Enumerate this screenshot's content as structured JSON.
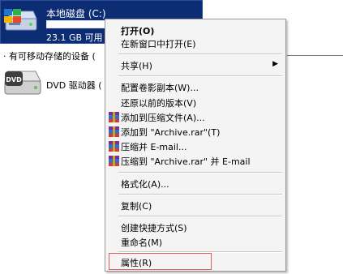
{
  "drive": {
    "title": "本地磁盘 (C:)",
    "free_text": "23.1 GB 可用",
    "usage_level": 1.0
  },
  "groups": {
    "removable_header": "有可移动存储的设备 (",
    "dvd_label": "DVD 驱动器 ("
  },
  "menu": {
    "open": "打开(O)",
    "open_new_window": "在新窗口中打开(E)",
    "share": "共享(H)",
    "restore_shadow": "配置卷影副本(W)...",
    "restore_previous": "还原以前的版本(V)",
    "add_to_archive": "添加到压缩文件(A)...",
    "add_to_rar": "添加到 \"Archive.rar\"(T)",
    "compress_email": "压缩并 E-mail...",
    "compress_rar_email": "压缩到 \"Archive.rar\" 并 E-mail",
    "format": "格式化(A)...",
    "copy": "复制(C)",
    "create_shortcut": "创建快捷方式(S)",
    "rename": "重命名(M)",
    "properties": "属性(R)"
  },
  "colors": {
    "selection": "#0c2c74",
    "highlight": "#e35b5b",
    "menu_bg": "#f4f4f4"
  },
  "icons": {
    "drive": "hard-drive-icon",
    "dvd": "dvd-drive-icon",
    "archive": "winrar-icon",
    "submenu": "chevron-right-icon"
  }
}
